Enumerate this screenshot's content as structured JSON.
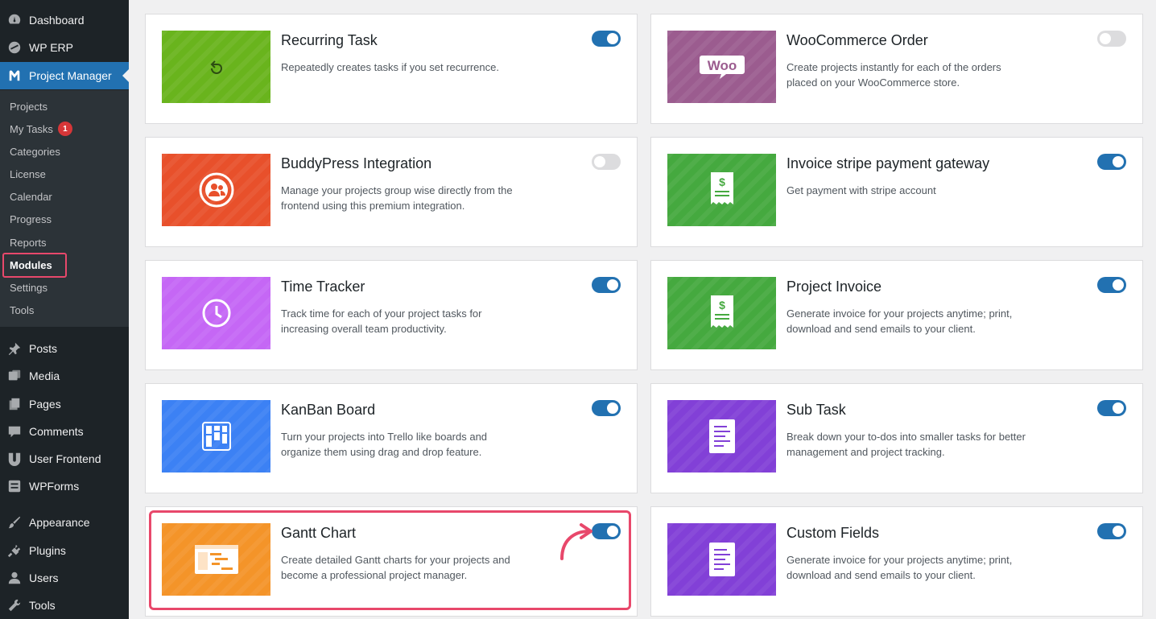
{
  "sidebar": {
    "top_items": [
      {
        "label": "Dashboard",
        "icon": "dashboard-icon"
      },
      {
        "label": "WP ERP",
        "icon": "erp-icon"
      },
      {
        "label": "Project Manager",
        "icon": "project-manager-icon"
      }
    ],
    "submenu": [
      {
        "label": "Projects"
      },
      {
        "label": "My Tasks",
        "badge": "1"
      },
      {
        "label": "Categories"
      },
      {
        "label": "License"
      },
      {
        "label": "Calendar"
      },
      {
        "label": "Progress"
      },
      {
        "label": "Reports"
      },
      {
        "label": "Modules"
      },
      {
        "label": "Settings"
      },
      {
        "label": "Tools"
      }
    ],
    "bottom_items": [
      {
        "label": "Posts",
        "icon": "pin-icon"
      },
      {
        "label": "Media",
        "icon": "media-icon"
      },
      {
        "label": "Pages",
        "icon": "pages-icon"
      },
      {
        "label": "Comments",
        "icon": "comment-icon"
      },
      {
        "label": "User Frontend",
        "icon": "user-frontend-icon"
      },
      {
        "label": "WPForms",
        "icon": "forms-icon"
      },
      {
        "label": "Appearance",
        "icon": "brush-icon"
      },
      {
        "label": "Plugins",
        "icon": "plugin-icon"
      },
      {
        "label": "Users",
        "icon": "user-icon"
      },
      {
        "label": "Tools",
        "icon": "wrench-icon"
      }
    ]
  },
  "modules": [
    {
      "title": "Recurring Task",
      "desc": "Repeatedly creates tasks if you set recurrence.",
      "enabled": true,
      "color": "#69b41d",
      "icon": "recurring-icon"
    },
    {
      "title": "WooCommerce Order",
      "desc": "Create projects instantly for each of the orders placed on your WooCommerce store.",
      "enabled": false,
      "color": "#9b5c8f",
      "icon": "woo-icon",
      "icon_text": "Woo"
    },
    {
      "title": "BuddyPress Integration",
      "desc": "Manage your projects group wise directly from the frontend using this premium integration.",
      "enabled": false,
      "color": "#e8502b",
      "icon": "buddypress-icon"
    },
    {
      "title": "Invoice stripe payment gateway",
      "desc": "Get payment with stripe account",
      "enabled": true,
      "color": "#45a93f",
      "icon": "invoice-icon"
    },
    {
      "title": "Time Tracker",
      "desc": "Track time for each of your project tasks for increasing overall team productivity.",
      "enabled": true,
      "color": "#c567f5",
      "icon": "clock-icon"
    },
    {
      "title": "Project Invoice",
      "desc": "Generate invoice for your projects anytime; print, download and send emails to your client.",
      "enabled": true,
      "color": "#45a93f",
      "icon": "invoice-icon"
    },
    {
      "title": "KanBan Board",
      "desc": "Turn your projects into Trello like boards and organize them using drag and drop feature.",
      "enabled": true,
      "color": "#3c81f4",
      "icon": "kanban-icon"
    },
    {
      "title": "Sub Task",
      "desc": "Break down your to-dos into smaller tasks for better management and project tracking.",
      "enabled": true,
      "color": "#8240d7",
      "icon": "list-icon"
    },
    {
      "title": "Gantt Chart",
      "desc": "Create detailed Gantt charts for your projects and become a professional project manager.",
      "enabled": true,
      "color": "#f49429",
      "icon": "gantt-icon"
    },
    {
      "title": "Custom Fields",
      "desc": "Generate invoice for your projects anytime; print, download and send emails to your client.",
      "enabled": true,
      "color": "#8240d7",
      "icon": "list-icon"
    }
  ]
}
